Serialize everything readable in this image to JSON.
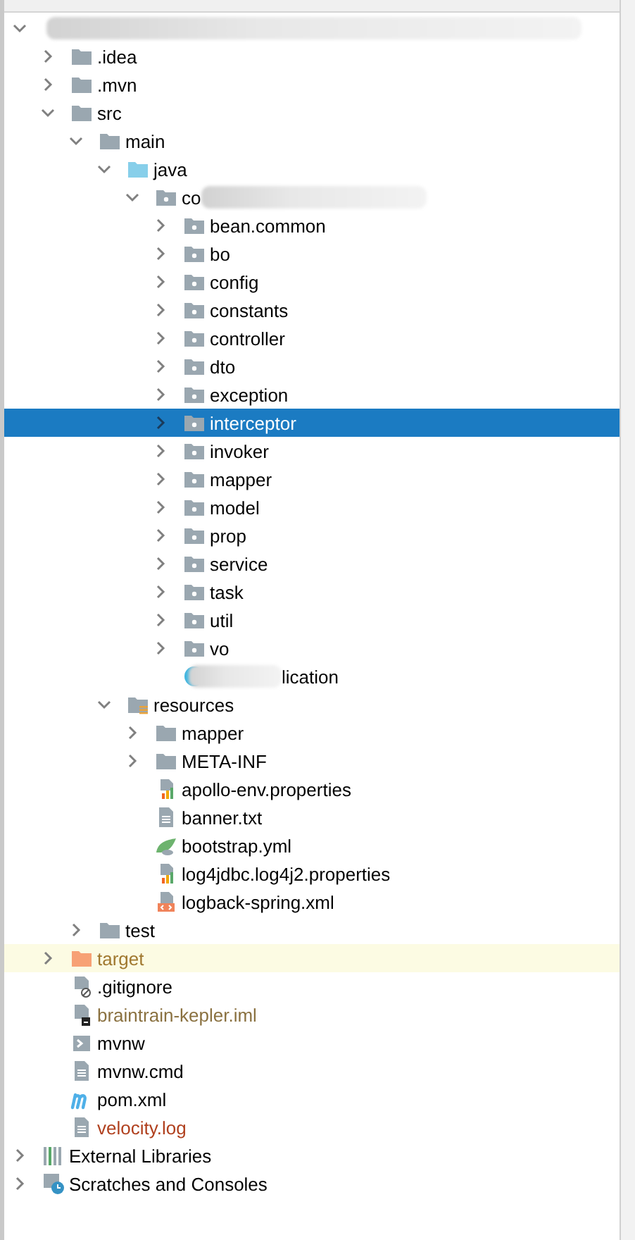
{
  "project_tree": {
    "nodes": [
      {
        "kind": "root",
        "blurred": true,
        "expanded": true,
        "selected": false,
        "highlighted": false,
        "children": [
          {
            "kind": "folder",
            "label": ".idea",
            "expanded": false,
            "selected": false,
            "highlighted": false
          },
          {
            "kind": "folder",
            "label": ".mvn",
            "expanded": false,
            "selected": false,
            "highlighted": false
          },
          {
            "kind": "folder",
            "label": "src",
            "expanded": true,
            "selected": false,
            "highlighted": false,
            "children": [
              {
                "kind": "folder",
                "label": "main",
                "expanded": true,
                "selected": false,
                "highlighted": false,
                "children": [
                  {
                    "kind": "source",
                    "label": "java",
                    "expanded": true,
                    "selected": false,
                    "highlighted": false,
                    "children": [
                      {
                        "kind": "package",
                        "label": "co",
                        "blurred_after": true,
                        "expanded": true,
                        "selected": false,
                        "highlighted": false,
                        "children": [
                          {
                            "kind": "package",
                            "label": "bean.common",
                            "expanded": false,
                            "selected": false,
                            "highlighted": false
                          },
                          {
                            "kind": "package",
                            "label": "bo",
                            "expanded": false,
                            "selected": false,
                            "highlighted": false
                          },
                          {
                            "kind": "package",
                            "label": "config",
                            "expanded": false,
                            "selected": false,
                            "highlighted": false
                          },
                          {
                            "kind": "package",
                            "label": "constants",
                            "expanded": false,
                            "selected": false,
                            "highlighted": false
                          },
                          {
                            "kind": "package",
                            "label": "controller",
                            "expanded": false,
                            "selected": false,
                            "highlighted": false
                          },
                          {
                            "kind": "package",
                            "label": "dto",
                            "expanded": false,
                            "selected": false,
                            "highlighted": false
                          },
                          {
                            "kind": "package",
                            "label": "exception",
                            "expanded": false,
                            "selected": false,
                            "highlighted": false
                          },
                          {
                            "kind": "package",
                            "label": "interceptor",
                            "expanded": false,
                            "selected": true,
                            "highlighted": false
                          },
                          {
                            "kind": "package",
                            "label": "invoker",
                            "expanded": false,
                            "selected": false,
                            "highlighted": false
                          },
                          {
                            "kind": "package",
                            "label": "mapper",
                            "expanded": false,
                            "selected": false,
                            "highlighted": false
                          },
                          {
                            "kind": "package",
                            "label": "model",
                            "expanded": false,
                            "selected": false,
                            "highlighted": false
                          },
                          {
                            "kind": "package",
                            "label": "prop",
                            "expanded": false,
                            "selected": false,
                            "highlighted": false
                          },
                          {
                            "kind": "package",
                            "label": "service",
                            "expanded": false,
                            "selected": false,
                            "highlighted": false
                          },
                          {
                            "kind": "package",
                            "label": "task",
                            "expanded": false,
                            "selected": false,
                            "highlighted": false
                          },
                          {
                            "kind": "package",
                            "label": "util",
                            "expanded": false,
                            "selected": false,
                            "highlighted": false
                          },
                          {
                            "kind": "package",
                            "label": "vo",
                            "expanded": false,
                            "selected": false,
                            "highlighted": false
                          },
                          {
                            "kind": "class",
                            "label": "lication",
                            "blurred_before": true,
                            "selected": false,
                            "highlighted": false
                          }
                        ]
                      }
                    ]
                  },
                  {
                    "kind": "resources",
                    "label": "resources",
                    "expanded": true,
                    "selected": false,
                    "highlighted": false,
                    "children": [
                      {
                        "kind": "folder",
                        "label": "mapper",
                        "expanded": false,
                        "selected": false,
                        "highlighted": false
                      },
                      {
                        "kind": "folder",
                        "label": "META-INF",
                        "expanded": false,
                        "selected": false,
                        "highlighted": false
                      },
                      {
                        "kind": "properties",
                        "label": "apollo-env.properties",
                        "selected": false,
                        "highlighted": false
                      },
                      {
                        "kind": "text",
                        "label": "banner.txt",
                        "selected": false,
                        "highlighted": false
                      },
                      {
                        "kind": "yml",
                        "label": "bootstrap.yml",
                        "selected": false,
                        "highlighted": false
                      },
                      {
                        "kind": "properties",
                        "label": "log4jdbc.log4j2.properties",
                        "selected": false,
                        "highlighted": false
                      },
                      {
                        "kind": "xml",
                        "label": "logback-spring.xml",
                        "selected": false,
                        "highlighted": false
                      }
                    ]
                  }
                ]
              },
              {
                "kind": "folder",
                "label": "test",
                "expanded": false,
                "selected": false,
                "highlighted": false
              }
            ]
          },
          {
            "kind": "excluded",
            "label": "target",
            "color": "#a0782f",
            "expanded": false,
            "selected": false,
            "highlighted": true
          },
          {
            "kind": "gitignore",
            "label": ".gitignore",
            "selected": false,
            "highlighted": false
          },
          {
            "kind": "iml",
            "label": "braintrain-kepler.iml",
            "color": "#8a7140",
            "selected": false,
            "highlighted": false
          },
          {
            "kind": "script",
            "label": "mvnw",
            "selected": false,
            "highlighted": false
          },
          {
            "kind": "text",
            "label": "mvnw.cmd",
            "selected": false,
            "highlighted": false
          },
          {
            "kind": "maven",
            "label": "pom.xml",
            "selected": false,
            "highlighted": false
          },
          {
            "kind": "text",
            "label": "velocity.log",
            "color": "#b0401e",
            "selected": false,
            "highlighted": false
          }
        ]
      },
      {
        "kind": "libraries",
        "label": "External Libraries",
        "expanded": false,
        "selected": false,
        "highlighted": false
      },
      {
        "kind": "scratches",
        "label": "Scratches and Consoles",
        "expanded": false,
        "selected": false,
        "highlighted": false
      }
    ]
  }
}
